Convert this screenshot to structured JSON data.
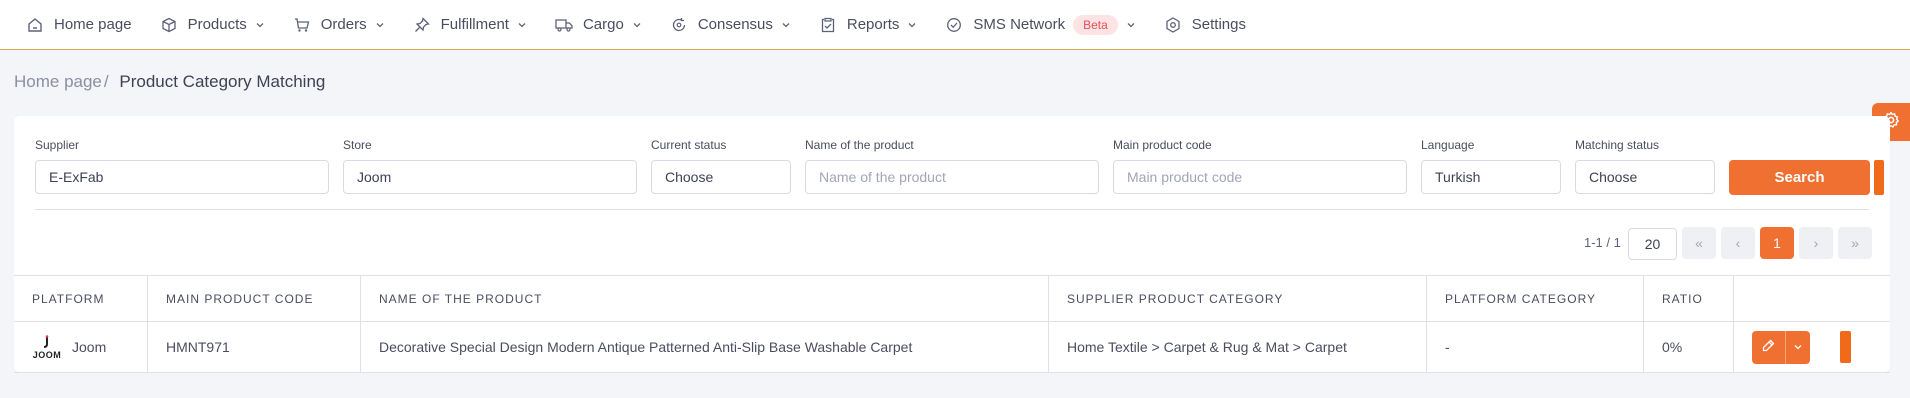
{
  "nav": {
    "items": [
      {
        "label": "Home page",
        "icon": "home-icon",
        "has_chevron": false
      },
      {
        "label": "Products",
        "icon": "box-icon",
        "has_chevron": true
      },
      {
        "label": "Orders",
        "icon": "cart-icon",
        "has_chevron": true
      },
      {
        "label": "Fulfillment",
        "icon": "pin-icon",
        "has_chevron": true
      },
      {
        "label": "Cargo",
        "icon": "truck-icon",
        "has_chevron": true
      },
      {
        "label": "Consensus",
        "icon": "sync-icon",
        "has_chevron": true
      },
      {
        "label": "Reports",
        "icon": "clipboard-icon",
        "has_chevron": true
      },
      {
        "label": "SMS Network",
        "icon": "check-circle-icon",
        "has_chevron": true,
        "badge": "Beta"
      },
      {
        "label": "Settings",
        "icon": "gear-icon",
        "has_chevron": false
      }
    ]
  },
  "breadcrumb": {
    "home": "Home page",
    "separator": "/",
    "current": "Product Category Matching"
  },
  "filters": {
    "supplier": {
      "label": "Supplier",
      "value": "E-ExFab"
    },
    "store": {
      "label": "Store",
      "value": "Joom"
    },
    "current_status": {
      "label": "Current status",
      "value": "Choose"
    },
    "product_name": {
      "label": "Name of the product",
      "placeholder": "Name of the product"
    },
    "main_product_code": {
      "label": "Main product code",
      "placeholder": "Main product code"
    },
    "language": {
      "label": "Language",
      "value": "Turkish"
    },
    "matching_status": {
      "label": "Matching status",
      "value": "Choose"
    },
    "search_label": "Search"
  },
  "pagination": {
    "range": "1-1 / 1",
    "page_size": "20",
    "first": "«",
    "prev": "‹",
    "current": "1",
    "next": "›",
    "last": "»"
  },
  "table": {
    "headers": [
      "PLATFORM",
      "MAIN PRODUCT CODE",
      "NAME OF THE PRODUCT",
      "SUPPLIER PRODUCT CATEGORY",
      "PLATFORM CATEGORY",
      "RATIO",
      ""
    ],
    "rows": [
      {
        "platform": "Joom",
        "platform_logo_text": "JOOM",
        "main_product_code": "HMNT971",
        "product_name": "Decorative Special Design Modern Antique Patterned Anti-Slip Base Washable Carpet",
        "supplier_category": "Home Textile > Carpet & Rug & Mat > Carpet",
        "platform_category": "-",
        "ratio": "0%"
      }
    ]
  },
  "colors": {
    "accent": "#f07032",
    "nav_border": "#e0a458",
    "beta_bg": "#fde3e3",
    "beta_text": "#e2505c"
  }
}
